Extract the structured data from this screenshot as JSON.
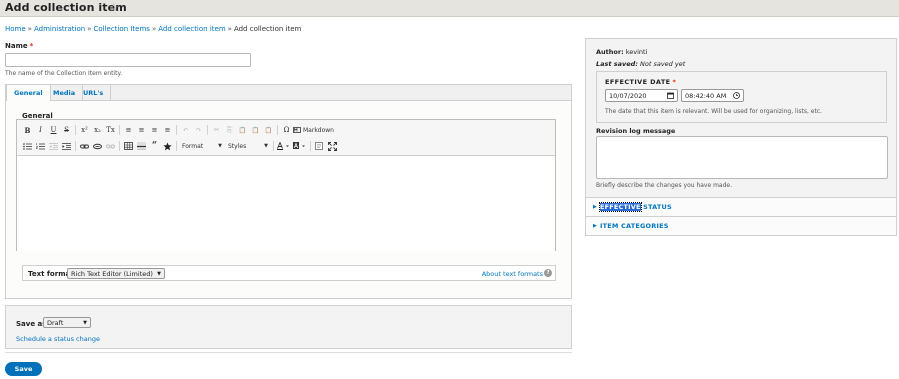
{
  "header": {
    "title": "Add collection item",
    "star_icon": "☆"
  },
  "breadcrumb": {
    "items": [
      "Home",
      "Administration",
      "Collection Items",
      "Add collection item"
    ],
    "current": "Add collection item",
    "separator": "»"
  },
  "name_field": {
    "label": "Name",
    "required": "*",
    "value": "",
    "description": "The name of the Collection Item entity."
  },
  "tabs": [
    {
      "label": "General",
      "active": true
    },
    {
      "label": "Media",
      "active": false
    },
    {
      "label": "URL's",
      "active": false
    }
  ],
  "general": {
    "label": "General"
  },
  "editor": {
    "row1": [
      "B",
      "I",
      "U",
      "S",
      "x²",
      "x₂",
      "Tx",
      "≡",
      "≡",
      "≡",
      "≡",
      "↶",
      "↷",
      "✂",
      "⎘",
      "📋",
      "📋",
      "📋",
      "Ω"
    ],
    "markdown_label": "Markdown",
    "format_combo": "Format",
    "styles_combo": "Styles"
  },
  "text_format": {
    "label": "Text format",
    "selected": "Rich Text Editor (Limited)",
    "about_link": "About text formats",
    "help_glyph": "?"
  },
  "save_as": {
    "label": "Save as:",
    "selected": "Draft",
    "schedule_link": "Schedule a status change"
  },
  "save_button": "Save",
  "sidebar": {
    "author_label": "Author:",
    "author_value": "kevinti",
    "last_saved_label": "Last saved:",
    "last_saved_value": "Not saved yet",
    "effective_date": {
      "title": "EFFECTIVE DATE",
      "required": "*",
      "date_value": "10/07/2020",
      "time_value": "08:42:40 AM",
      "description": "The date that this item is relevant. Will be used for organizing, lists, etc."
    },
    "revision": {
      "label": "Revision log message",
      "value": "",
      "description": "Briefly describe the changes you have made."
    },
    "accordions": [
      {
        "label_highlight": "EFFECTIVE",
        "label_rest": " STATUS"
      },
      {
        "label_highlight": "",
        "label_rest": "ITEM CATEGORIES"
      }
    ]
  },
  "colors": {
    "link": "#0074bd",
    "save_button": "#0071b8",
    "required": "#e62600"
  }
}
